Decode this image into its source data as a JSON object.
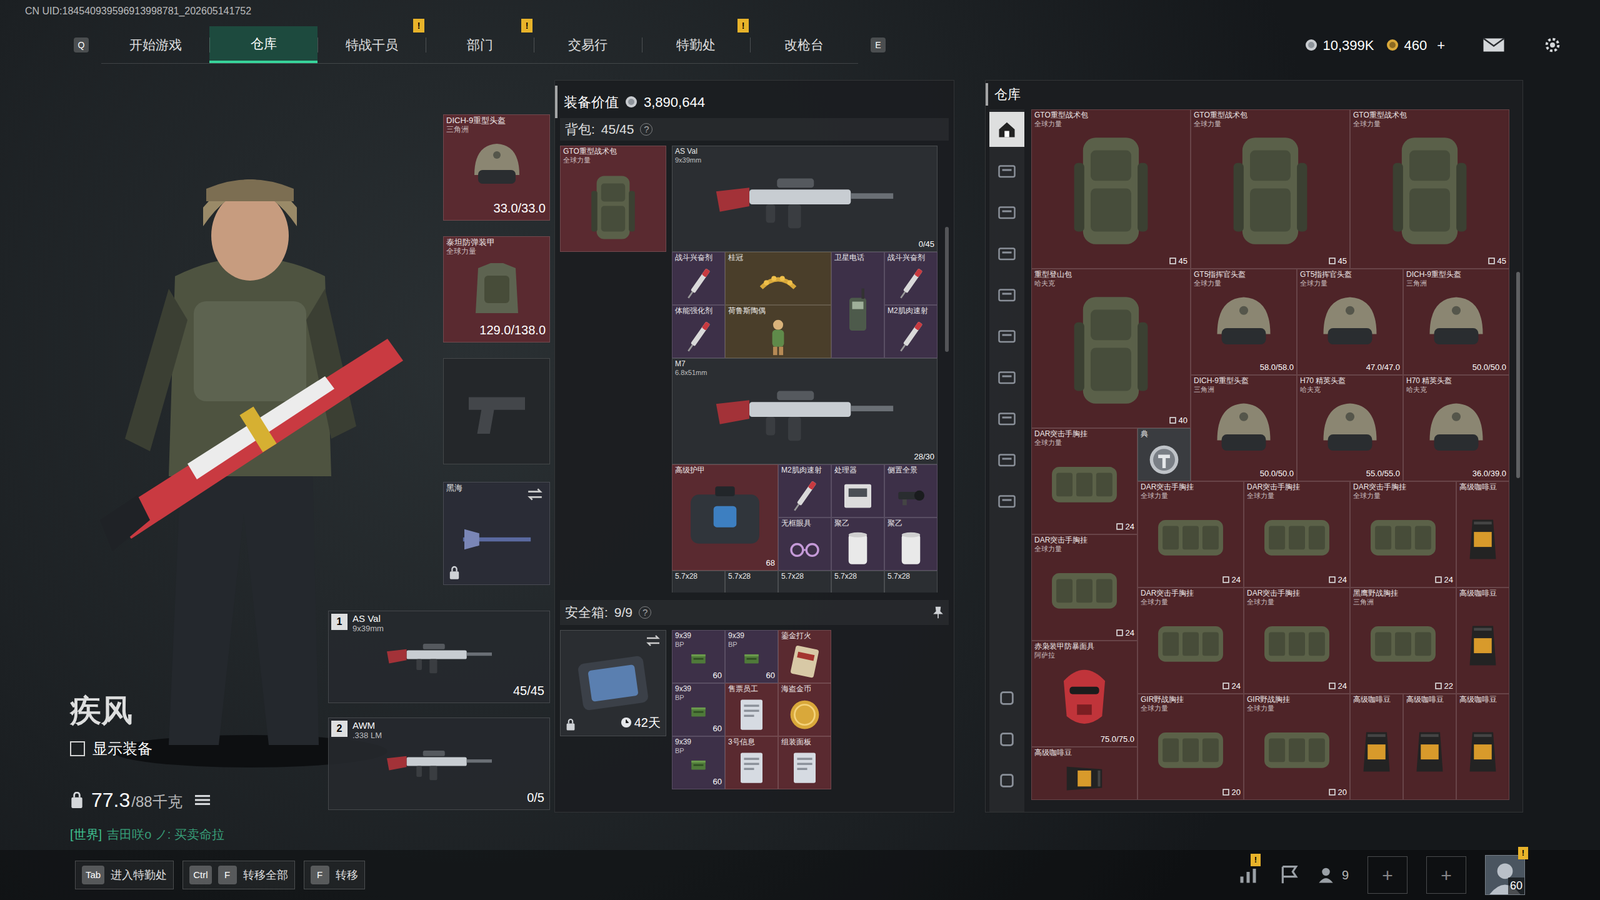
{
  "uid": "CN UID:184540939596913998781_202605141752",
  "nav": {
    "prev_key": "Q",
    "next_key": "E",
    "alert_glyph": "!",
    "tabs": [
      {
        "label": "开始游戏",
        "selected": false,
        "alert": false
      },
      {
        "label": "仓库",
        "selected": true,
        "alert": false
      },
      {
        "label": "特战干员",
        "selected": false,
        "alert": true
      },
      {
        "label": "部门",
        "selected": false,
        "alert": true
      },
      {
        "label": "交易行",
        "selected": false,
        "alert": false
      },
      {
        "label": "特勤处",
        "selected": false,
        "alert": true
      },
      {
        "label": "改枪台",
        "selected": false,
        "alert": false
      }
    ]
  },
  "wallet": {
    "coins": "10,399K",
    "tokens": "460",
    "add": "+"
  },
  "operator": {
    "name": "疾风",
    "show_equipment": {
      "label": "显示装备",
      "checked": false
    },
    "weight": "77.3",
    "weight_max": "/88千克",
    "chat": {
      "channel": "[世界]",
      "text": "吉田咲o ノ: 买卖命拉"
    }
  },
  "gear": {
    "helmet": {
      "name": "DICH-9重型头盔",
      "origin": "三角洲",
      "durability": "33.0/33.0",
      "color": "#5a2a30"
    },
    "armor": {
      "name": "泰坦防弹装甲",
      "origin": "全球力量",
      "durability": "129.0/138.0",
      "color": "#5a2a30"
    },
    "pistol": {
      "empty": true,
      "color": "#24272a"
    },
    "melee": {
      "name": "黑海",
      "locked": true,
      "color": "#2a2c36"
    }
  },
  "weapons": [
    {
      "slot": "1",
      "name": "AS Val",
      "caliber": "9x39mm",
      "ammo": "45/45"
    },
    {
      "slot": "2",
      "name": "AWM",
      "caliber": ".338 LM",
      "ammo": "0/5"
    }
  ],
  "loadout": {
    "value_label": "装备价值",
    "value": "3,890,644",
    "backpack": {
      "label": "背包:",
      "capacity": "45/45",
      "help": "?",
      "bag": {
        "name": "GTO重型战术包",
        "origin": "全球力量",
        "color": "#5a2a30"
      },
      "items": [
        {
          "name": "AS Val",
          "origin": "9x39mm",
          "value": "0/45",
          "kind": "gun",
          "color": "#2b2e32"
        },
        {
          "name": "战斗兴奋剂",
          "kind": "syringe",
          "color": "#3d3048"
        },
        {
          "name": "桂冠",
          "kind": "crown",
          "color": "#4a3e2a"
        },
        {
          "name": "卫星电话",
          "kind": "phone",
          "color": "#3d3048"
        },
        {
          "name": "战斗兴奋剂",
          "kind": "syringe",
          "color": "#3d3048"
        },
        {
          "name": "体能强化剂",
          "kind": "syringe",
          "color": "#3d3048"
        },
        {
          "name": "荷鲁斯陶偶",
          "kind": "figurine",
          "color": "#4a3e2a"
        },
        {
          "name": "M2肌肉速射",
          "kind": "syringe",
          "color": "#3d3048"
        },
        {
          "name": "M7",
          "origin": "6.8x51mm",
          "value": "28/30",
          "kind": "gun",
          "color": "#2b2e32"
        },
        {
          "name": "高级护甲",
          "value": "68",
          "kind": "case",
          "color": "#5a2a30"
        },
        {
          "name": "M2肌肉速射",
          "kind": "syringe",
          "color": "#3d3048"
        },
        {
          "name": "处理器",
          "kind": "device",
          "color": "#3d3048"
        },
        {
          "name": "侧置全景",
          "kind": "scope",
          "color": "#3d3048"
        },
        {
          "name": "无框眼具",
          "kind": "glasses",
          "color": "#3d3048"
        },
        {
          "name": "聚乙",
          "kind": "roll",
          "color": "#3d3048"
        },
        {
          "name": "聚乙",
          "kind": "roll",
          "color": "#3d3048"
        },
        {
          "name": "5.7x28",
          "kind": "ammo",
          "color": "#2b2e32"
        },
        {
          "name": "5.7x28",
          "kind": "ammo",
          "color": "#2b2e32"
        },
        {
          "name": "5.7x28",
          "kind": "ammo",
          "color": "#2b2e32"
        },
        {
          "name": "5.7x28",
          "kind": "ammo",
          "color": "#2b2e32"
        },
        {
          "name": "5.7x28",
          "kind": "ammo",
          "color": "#2b2e32"
        }
      ]
    },
    "safebox": {
      "label": "安全箱:",
      "capacity": "9/9",
      "help": "?",
      "days": "42天",
      "locked": true,
      "items": [
        {
          "name": "9x39",
          "origin": "BP",
          "value": "60",
          "kind": "ammo",
          "color": "#3d3048"
        },
        {
          "name": "9x39",
          "origin": "BP",
          "value": "60",
          "kind": "ammo",
          "color": "#3d3048"
        },
        {
          "name": "鎏金打火",
          "kind": "card",
          "color": "#5a2a30"
        },
        {
          "name": "9x39",
          "origin": "BP",
          "value": "60",
          "kind": "ammo",
          "color": "#3d3048"
        },
        {
          "name": "售票员工",
          "kind": "document",
          "color": "#5a2a30"
        },
        {
          "name": "海盗金币",
          "kind": "coin",
          "color": "#5a2a30"
        },
        {
          "name": "9x39",
          "origin": "BP",
          "value": "60",
          "kind": "ammo",
          "color": "#3d3048"
        },
        {
          "name": "3号信息",
          "kind": "document",
          "color": "#5a2a30"
        },
        {
          "name": "组装面板",
          "kind": "document",
          "color": "#5a2a30"
        }
      ]
    }
  },
  "warehouse": {
    "title": "仓库",
    "items": [
      {
        "name": "GTO重型战术包",
        "origin": "全球力量",
        "value": "45",
        "kind": "backpack",
        "color": "#4e2428"
      },
      {
        "name": "GTO重型战术包",
        "origin": "全球力量",
        "value": "45",
        "kind": "backpack",
        "color": "#4e2428"
      },
      {
        "name": "GTO重型战术包",
        "origin": "全球力量",
        "value": "45",
        "kind": "backpack",
        "color": "#4e2428"
      },
      {
        "name": "重型登山包",
        "origin": "哈夫克",
        "value": "40",
        "kind": "backpack",
        "color": "#4e2428"
      },
      {
        "name": "GT5指挥官头盔",
        "origin": "全球力量",
        "value": "58.0/58.0",
        "kind": "helmet",
        "color": "#4e2428"
      },
      {
        "name": "GT5指挥官头盔",
        "origin": "全球力量",
        "value": "47.0/47.0",
        "kind": "helmet",
        "color": "#4e2428"
      },
      {
        "name": "DICH-9重型头盔",
        "origin": "三角洲",
        "value": "50.0/50.0",
        "kind": "helmet",
        "color": "#4e2428"
      },
      {
        "name": "DICH-9重型头盔",
        "origin": "三角洲",
        "value": "50.0/50.0",
        "kind": "helmet",
        "color": "#4e2428"
      },
      {
        "name": "H70 精英头盔",
        "origin": "哈夫克",
        "value": "55.0/55.0",
        "kind": "helmet",
        "color": "#4e2428"
      },
      {
        "name": "H70 精英头盔",
        "origin": "哈夫克",
        "value": "36.0/39.0",
        "kind": "helmet",
        "color": "#4e2428"
      },
      {
        "name": "DAR突击手胸挂",
        "origin": "全球力量",
        "value": "24",
        "kind": "rig",
        "color": "#4e2428"
      },
      {
        "name": "典",
        "kind": "emblem",
        "color": "#3a3c40"
      },
      {
        "name": "DAR突击手胸挂",
        "origin": "全球力量",
        "value": "24",
        "kind": "rig",
        "color": "#4e2428"
      },
      {
        "name": "DAR突击手胸挂",
        "origin": "全球力量",
        "value": "24",
        "kind": "rig",
        "color": "#4e2428"
      },
      {
        "name": "DAR突击手胸挂",
        "origin": "全球力量",
        "value": "24",
        "kind": "rig",
        "color": "#4e2428"
      },
      {
        "name": "高级咖啡豆",
        "kind": "coffee",
        "rotated": false,
        "color": "#4e2428"
      },
      {
        "name": "DAR突击手胸挂",
        "origin": "全球力量",
        "value": "24",
        "kind": "rig",
        "color": "#4e2428"
      },
      {
        "name": "DAR突击手胸挂",
        "origin": "全球力量",
        "value": "24",
        "kind": "rig",
        "color": "#4e2428"
      },
      {
        "name": "DAR突击手胸挂",
        "origin": "全球力量",
        "value": "24",
        "kind": "rig",
        "color": "#4e2428"
      },
      {
        "name": "黑鹰野战胸挂",
        "origin": "三角洲",
        "value": "22",
        "kind": "rig",
        "color": "#4e2428"
      },
      {
        "name": "高级咖啡豆",
        "kind": "coffee",
        "rotated": false,
        "color": "#4e2428"
      },
      {
        "name": "赤枭装甲防暴面具",
        "origin": "阿萨拉",
        "value": "75.0/75.0",
        "kind": "mask",
        "color": "#4e2428"
      },
      {
        "name": "GIR野战胸挂",
        "origin": "全球力量",
        "value": "20",
        "kind": "rig",
        "color": "#4e2428"
      },
      {
        "name": "GIR野战胸挂",
        "origin": "全球力量",
        "value": "20",
        "kind": "rig",
        "color": "#4e2428"
      },
      {
        "name": "高级咖啡豆",
        "kind": "coffee",
        "rotated": false,
        "color": "#4e2428"
      },
      {
        "name": "高级咖啡豆",
        "kind": "coffee",
        "rotated": false,
        "color": "#4e2428"
      },
      {
        "name": "高级咖啡豆",
        "kind": "coffee",
        "rotated": false,
        "color": "#4e2428"
      },
      {
        "name": "高级咖啡豆",
        "kind": "coffee",
        "rotated": true,
        "color": "#4e2428"
      }
    ]
  },
  "footer": {
    "hints": [
      {
        "keys": [
          "Tab"
        ],
        "label": "进入特勤处"
      },
      {
        "keys": [
          "Ctrl",
          "F"
        ],
        "label": "转移全部"
      },
      {
        "keys": [
          "F"
        ],
        "label": "转移"
      }
    ],
    "stats_alert": true,
    "friends": "9",
    "add_slots": [
      "+",
      "+"
    ],
    "level": "60",
    "avatar_alert": true
  }
}
